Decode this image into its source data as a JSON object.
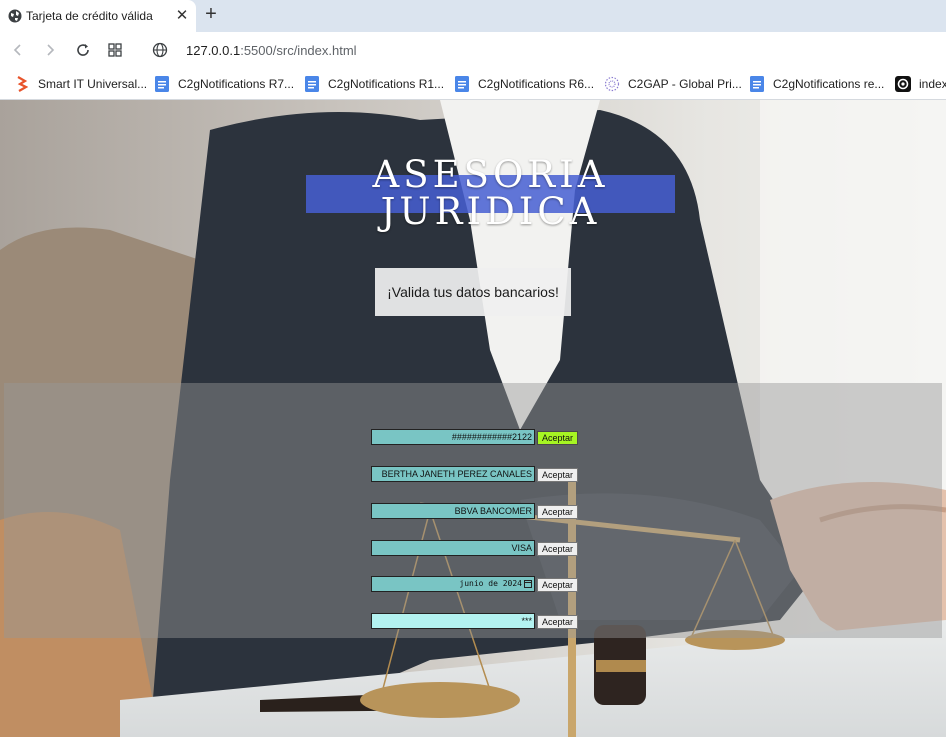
{
  "browser": {
    "tab_title": "Tarjeta de crédito válida",
    "url_host": "127.0.0.1",
    "url_path": ":5500/src/index.html",
    "bookmarks": [
      {
        "label": "Smart IT Universal...",
        "icon": "smart-it-icon"
      },
      {
        "label": "C2gNotifications R7...",
        "icon": "doc-icon"
      },
      {
        "label": "C2gNotifications R1...",
        "icon": "doc-icon"
      },
      {
        "label": "C2gNotifications R6...",
        "icon": "doc-icon"
      },
      {
        "label": "C2GAP - Global Pri...",
        "icon": "globe-dots-icon"
      },
      {
        "label": "C2gNotifications re...",
        "icon": "doc-icon"
      },
      {
        "label": "index",
        "icon": "circle-logo-icon"
      }
    ],
    "colors": {
      "tabstrip": "#dbe4ef",
      "doc_icon": "#4a86e8",
      "smart_icon": "#e8542b"
    }
  },
  "page": {
    "title_line1": "ASESORIA",
    "title_line2": "JURIDICA",
    "subtitle": "¡Valida tus datos bancarios!",
    "colors": {
      "title_band": "#465fd2",
      "field_teal": "#79c5c4",
      "field_cyan": "#b3f2f0",
      "button_active": "#a6f523"
    },
    "fields": [
      {
        "value": "############2122",
        "button": "Aceptar",
        "button_active": true
      },
      {
        "value": "BERTHA JANETH PEREZ CANALES",
        "button": "Aceptar",
        "button_active": false
      },
      {
        "value": "BBVA BANCOMER",
        "button": "Aceptar",
        "button_active": false
      },
      {
        "value": "VISA",
        "button": "Aceptar",
        "button_active": false
      },
      {
        "value": "junio de 2024",
        "button": "Aceptar",
        "button_active": false
      },
      {
        "value": "***",
        "button": "Aceptar",
        "button_active": false
      }
    ]
  }
}
